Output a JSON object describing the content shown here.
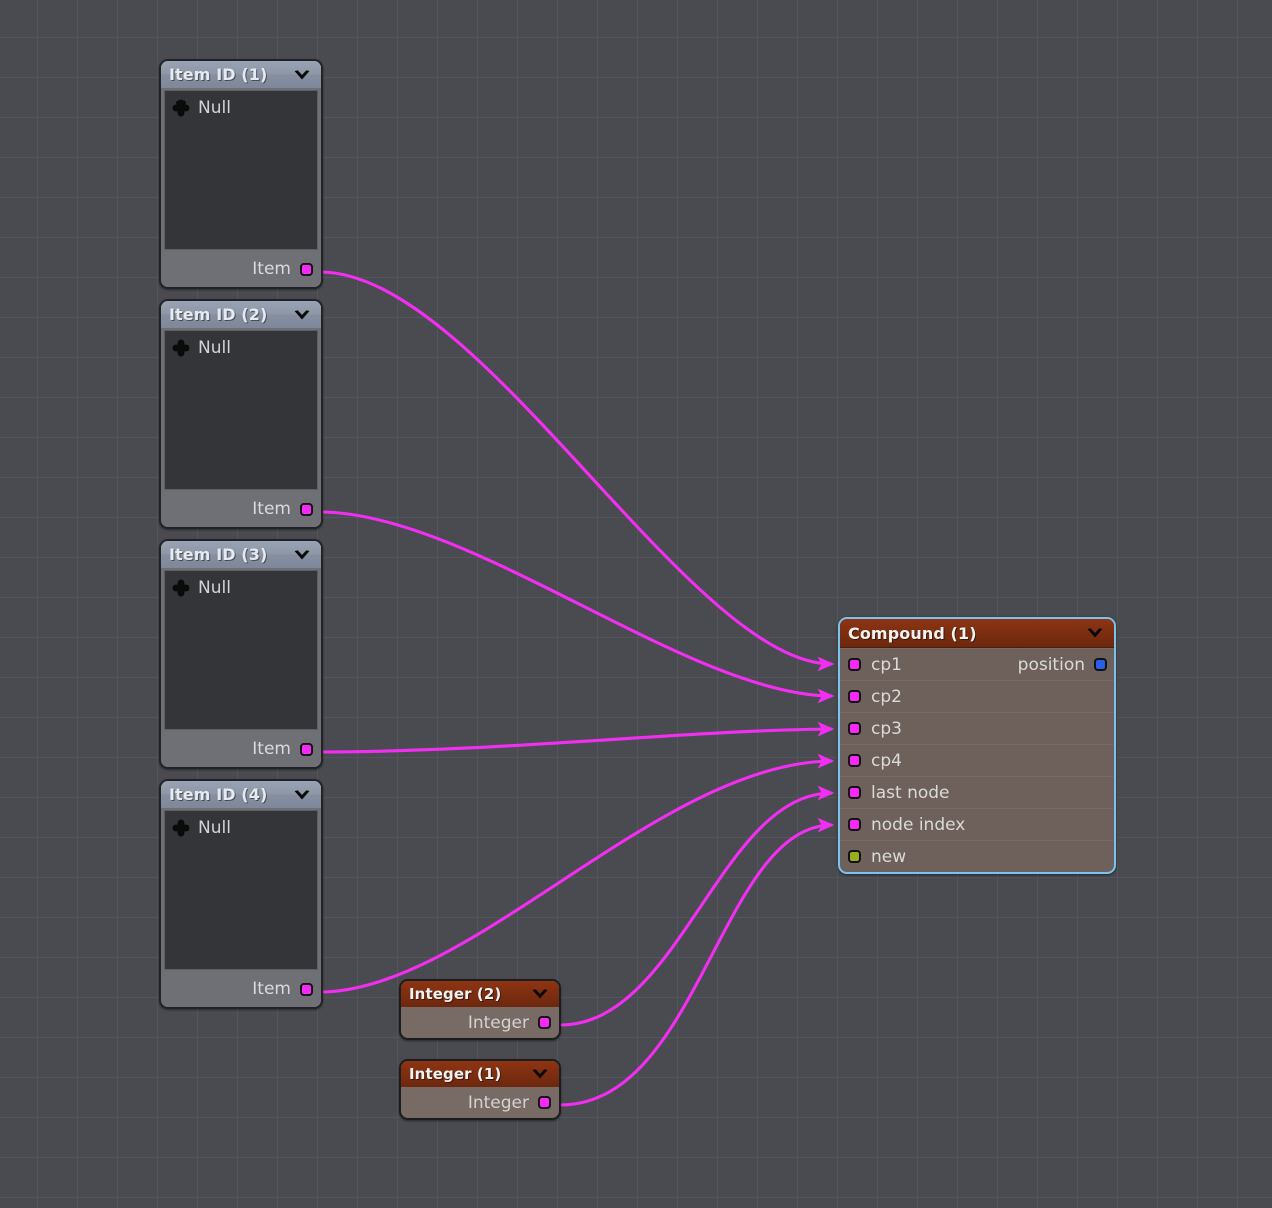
{
  "canvas": {
    "background_color": "#4a4b50",
    "grid_color": "#54555a",
    "grid_size_px": 40
  },
  "colors": {
    "wire": "#f22ef2",
    "socket_magenta": "#f629f6",
    "socket_blue": "#2b5fe8",
    "socket_olive": "#9aad1c",
    "itemid_header": "#8d97a7",
    "compound_header": "#7c2d10",
    "compound_body": "#6e615b",
    "selection_border": "#79c3ee"
  },
  "nodes": {
    "item_id_1": {
      "title": "Item ID (1)",
      "collapse_icon": "chevron-down-icon",
      "content_label": "Null",
      "content_icon": "cross-plus-icon",
      "output_label": "Item",
      "output_socket": "socket-magenta"
    },
    "item_id_2": {
      "title": "Item ID (2)",
      "collapse_icon": "chevron-down-icon",
      "content_label": "Null",
      "content_icon": "cross-plus-icon",
      "output_label": "Item",
      "output_socket": "socket-magenta"
    },
    "item_id_3": {
      "title": "Item ID (3)",
      "collapse_icon": "chevron-down-icon",
      "content_label": "Null",
      "content_icon": "cross-plus-icon",
      "output_label": "Item",
      "output_socket": "socket-magenta"
    },
    "item_id_4": {
      "title": "Item ID (4)",
      "collapse_icon": "chevron-down-icon",
      "content_label": "Null",
      "content_icon": "cross-plus-icon",
      "output_label": "Item",
      "output_socket": "socket-magenta"
    },
    "integer_2": {
      "title": "Integer (2)",
      "collapse_icon": "chevron-down-icon",
      "output_label": "Integer",
      "output_socket": "socket-magenta"
    },
    "integer_1": {
      "title": "Integer (1)",
      "collapse_icon": "chevron-down-icon",
      "output_label": "Integer",
      "output_socket": "socket-magenta"
    },
    "compound_1": {
      "title": "Compound (1)",
      "collapse_icon": "chevron-down-icon",
      "selected": true,
      "inputs": [
        {
          "label": "cp1",
          "socket": "socket-magenta"
        },
        {
          "label": "cp2",
          "socket": "socket-magenta"
        },
        {
          "label": "cp3",
          "socket": "socket-magenta"
        },
        {
          "label": "cp4",
          "socket": "socket-magenta"
        },
        {
          "label": "last node",
          "socket": "socket-magenta"
        },
        {
          "label": "node index",
          "socket": "socket-magenta"
        },
        {
          "label": "new",
          "socket": "socket-olive"
        }
      ],
      "outputs": [
        {
          "label": "position",
          "socket": "socket-blue"
        }
      ]
    }
  },
  "connections": [
    {
      "from": "item_id_1.Item",
      "to": "compound_1.cp1"
    },
    {
      "from": "item_id_2.Item",
      "to": "compound_1.cp2"
    },
    {
      "from": "item_id_3.Item",
      "to": "compound_1.cp3"
    },
    {
      "from": "item_id_4.Item",
      "to": "compound_1.cp4"
    },
    {
      "from": "integer_2.Integer",
      "to": "compound_1.last node"
    },
    {
      "from": "integer_1.Integer",
      "to": "compound_1.node index"
    }
  ]
}
